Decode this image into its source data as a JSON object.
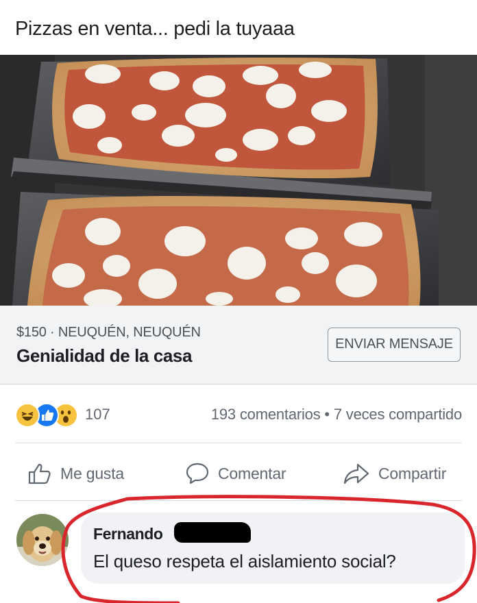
{
  "post": {
    "text": "Pizzas en venta... pedi la tuyaaa"
  },
  "listing": {
    "meta": "$150 · NEUQUÉN, NEUQUÉN",
    "title": "Genialidad de la casa",
    "message_button": "ENVIAR MENSAJE"
  },
  "engagement": {
    "reactions": [
      "haha",
      "like",
      "wow"
    ],
    "reaction_count": "107",
    "stats": "193 comentarios • 7 veces compartido"
  },
  "actions": {
    "like": "Me gusta",
    "comment": "Comentar",
    "share": "Compartir"
  },
  "comment": {
    "author": "Fernando",
    "text": "El queso respeta el aislamiento social?"
  },
  "colors": {
    "annotation_circle": "#d8262c",
    "like_blue": "#1877f2",
    "reaction_yellow": "#f7c33f"
  }
}
